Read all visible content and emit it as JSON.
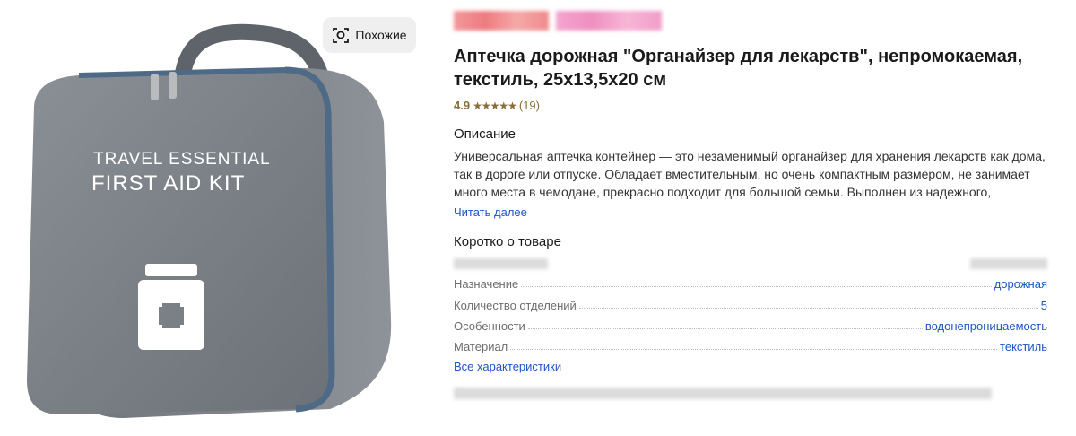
{
  "gallery": {
    "similar_label": "Похожие",
    "bag_text_line1": "TRAVEL ESSENTIAL",
    "bag_text_line2": "FIRST AID KIT",
    "icons": {
      "similar": "lens-search-icon",
      "badge": "first-aid-cross-icon"
    }
  },
  "product": {
    "title": "Аптечка дорожная \"Органайзер для лекарств\", непромокаемая, текстиль, 25х13,5х20 см",
    "rating": {
      "score": "4.9",
      "stars": "★★★★★",
      "count": "(19)",
      "value": 4.9
    },
    "description": {
      "heading": "Описание",
      "text": "Универсальная аптечка контейнер — это незаменимый органайзер для хранения лекарств как дома, так в дороге или отпуске. Обладает вместительным, но очень компактным размером, не занимает много места в чемодане, прекрасно подходит для большой семьи. Выполнен из надежного,",
      "read_more": "Читать далее"
    },
    "brief": {
      "heading": "Коротко о товаре",
      "specs": [
        {
          "key": "Назначение",
          "value": "дорожная"
        },
        {
          "key": "Количество отделений",
          "value": "5"
        },
        {
          "key": "Особенности",
          "value": "водонепроницаемость"
        },
        {
          "key": "Материал",
          "value": "текстиль"
        }
      ],
      "all_specs": "Все характеристики"
    }
  },
  "colors": {
    "link": "#1f55c4",
    "rating": "#8a6d3b",
    "bag": "#7b8187"
  }
}
